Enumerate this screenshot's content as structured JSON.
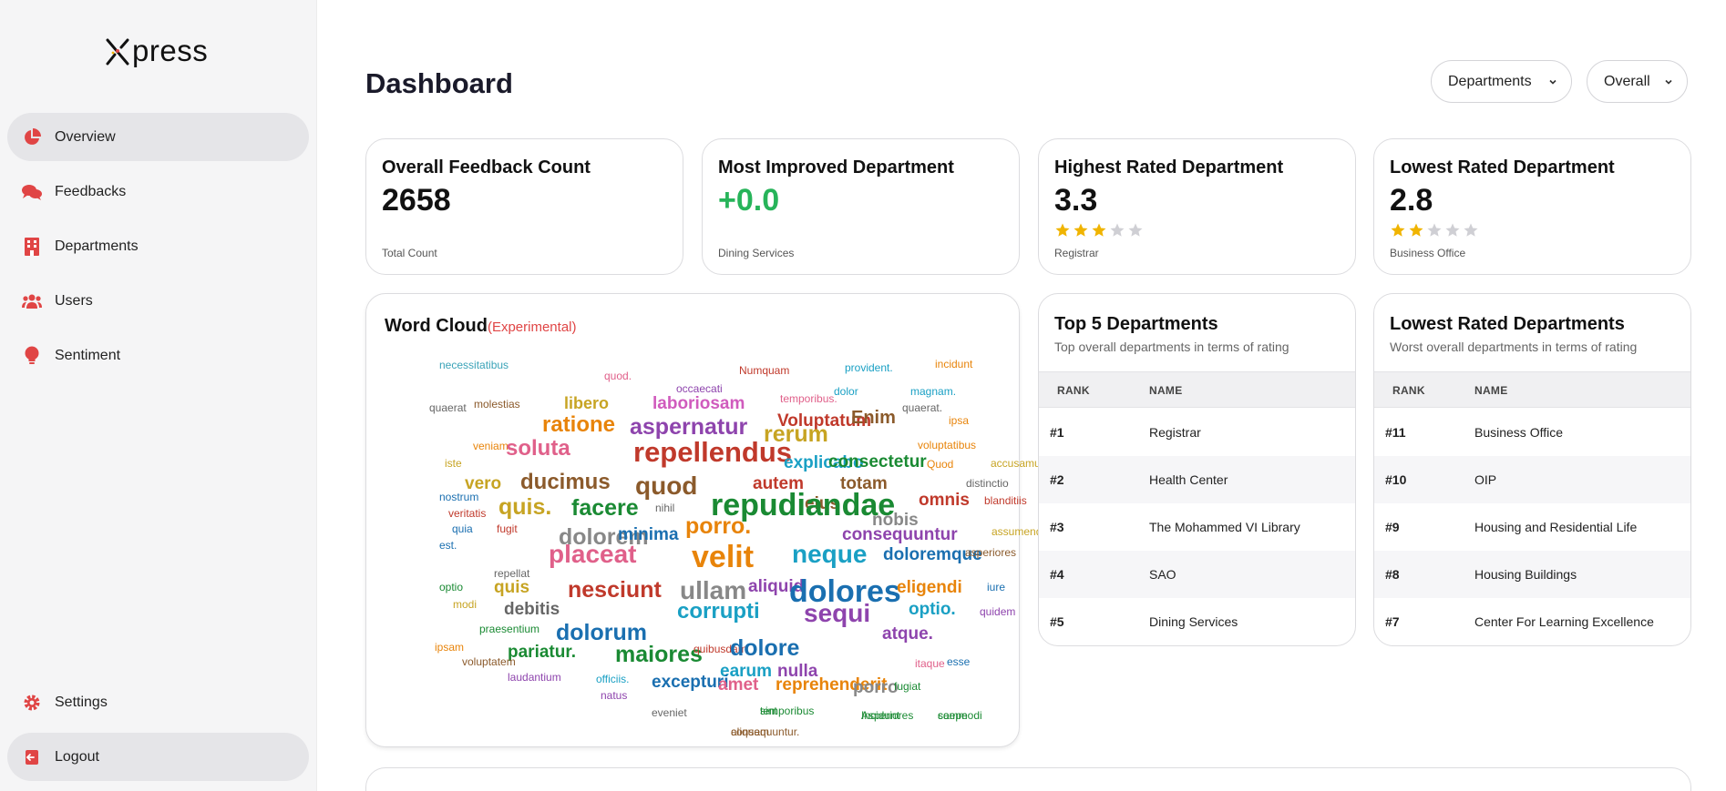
{
  "app": {
    "logo_x": "X",
    "logo_rest": "press"
  },
  "sidebar": {
    "items": [
      {
        "label": "Overview",
        "icon": "pie-chart-icon",
        "active": true
      },
      {
        "label": "Feedbacks",
        "icon": "chat-bubbles-icon"
      },
      {
        "label": "Departments",
        "icon": "building-icon"
      },
      {
        "label": "Users",
        "icon": "users-icon"
      },
      {
        "label": "Sentiment",
        "icon": "lightbulb-icon"
      }
    ],
    "bottom": [
      {
        "label": "Settings",
        "icon": "gear-icon"
      },
      {
        "label": "Logout",
        "icon": "logout-icon"
      }
    ]
  },
  "header": {
    "title": "Dashboard",
    "filters": [
      {
        "value": "Departments"
      },
      {
        "value": "Overall"
      }
    ]
  },
  "stats": [
    {
      "title": "Overall Feedback Count",
      "value": "2658",
      "sub": "Total Count"
    },
    {
      "title": "Most Improved Department",
      "value": "+0.0",
      "sub": "Dining Services"
    },
    {
      "title": "Highest Rated Department",
      "value": "3.3",
      "rating_stars": 3,
      "sub": "Registrar"
    },
    {
      "title": "Lowest Rated Department",
      "value": "2.8",
      "rating_stars": 2,
      "sub": "Business Office"
    }
  ],
  "word_cloud": {
    "title": "Word Cloud",
    "tag": "(Experimental)",
    "words": [
      "necessitatibus",
      "quod.",
      "incidunt",
      "Numquam",
      "provident.",
      "occaecati",
      "temporibus.",
      "quaerat",
      "magnam.",
      "molestias",
      "dolor",
      "libero",
      "laboriosam",
      "quaerat.",
      "Voluptatum",
      "ratione",
      "Enim",
      "ipsa",
      "aspernatur",
      "rerum",
      "veniam.",
      "soluta",
      "repellendus",
      "voluptatibus",
      "iste",
      "explicabo",
      "consectetur",
      "Quod",
      "accusamus",
      "vero",
      "ducimus",
      "quod",
      "autem",
      "totam",
      "distinctio",
      "nostrum",
      "omnis",
      "blanditiis",
      "quis.",
      "facere",
      "eius",
      "nihil",
      "fugit",
      "veritatis",
      "nobis",
      "repudiandae",
      "quia",
      "porro.",
      "assumenda.",
      "est.",
      "dolorem",
      "consequuntur",
      "minima",
      "placeat",
      "velit",
      "neque",
      "doloremque",
      "asperiores",
      "repellat",
      "optio",
      "quis",
      "nesciunt",
      "ullam",
      "aliquid",
      "dolores",
      "eligendi",
      "iure",
      "modi",
      "debitis",
      "corrupti",
      "sequi",
      "optio.",
      "quidem",
      "praesentium",
      "dolorum",
      "atque.",
      "ipsam",
      "pariatur.",
      "maiores",
      "quibusdam",
      "dolore",
      "voluptatem",
      "itaque",
      "esse",
      "laudantium",
      "earum",
      "nulla",
      "officiis.",
      "excepturi",
      "amet",
      "reprehenderit",
      "porro",
      "fugiat",
      "natus",
      "eveniet",
      "sint",
      "Asperiores",
      "saepe",
      "consequuntur.",
      "temporibus",
      "Incidunt",
      "commodi",
      "aliquam"
    ]
  },
  "top5": {
    "title": "Top 5 Departments",
    "subtitle": "Top overall departments in terms of rating",
    "col_rank": "RANK",
    "col_name": "NAME",
    "rows": [
      {
        "rank": "#1",
        "name": "Registrar"
      },
      {
        "rank": "#2",
        "name": "Health Center"
      },
      {
        "rank": "#3",
        "name": "The Mohammed VI Library"
      },
      {
        "rank": "#4",
        "name": "SAO"
      },
      {
        "rank": "#5",
        "name": "Dining Services"
      }
    ]
  },
  "lowest": {
    "title": "Lowest Rated Departments",
    "subtitle": "Worst overall departments in terms of rating",
    "col_rank": "RANK",
    "col_name": "NAME",
    "rows": [
      {
        "rank": "#11",
        "name": "Business Office"
      },
      {
        "rank": "#10",
        "name": "OIP"
      },
      {
        "rank": "#9",
        "name": "Housing and Residential Life"
      },
      {
        "rank": "#8",
        "name": "Housing Buildings"
      },
      {
        "rank": "#7",
        "name": "Center For Learning Excellence"
      }
    ]
  },
  "colors": {
    "accent": "#e04545",
    "positive": "#27b45a",
    "star_filled": "#f0b400",
    "star_empty": "#cfcfd4"
  }
}
